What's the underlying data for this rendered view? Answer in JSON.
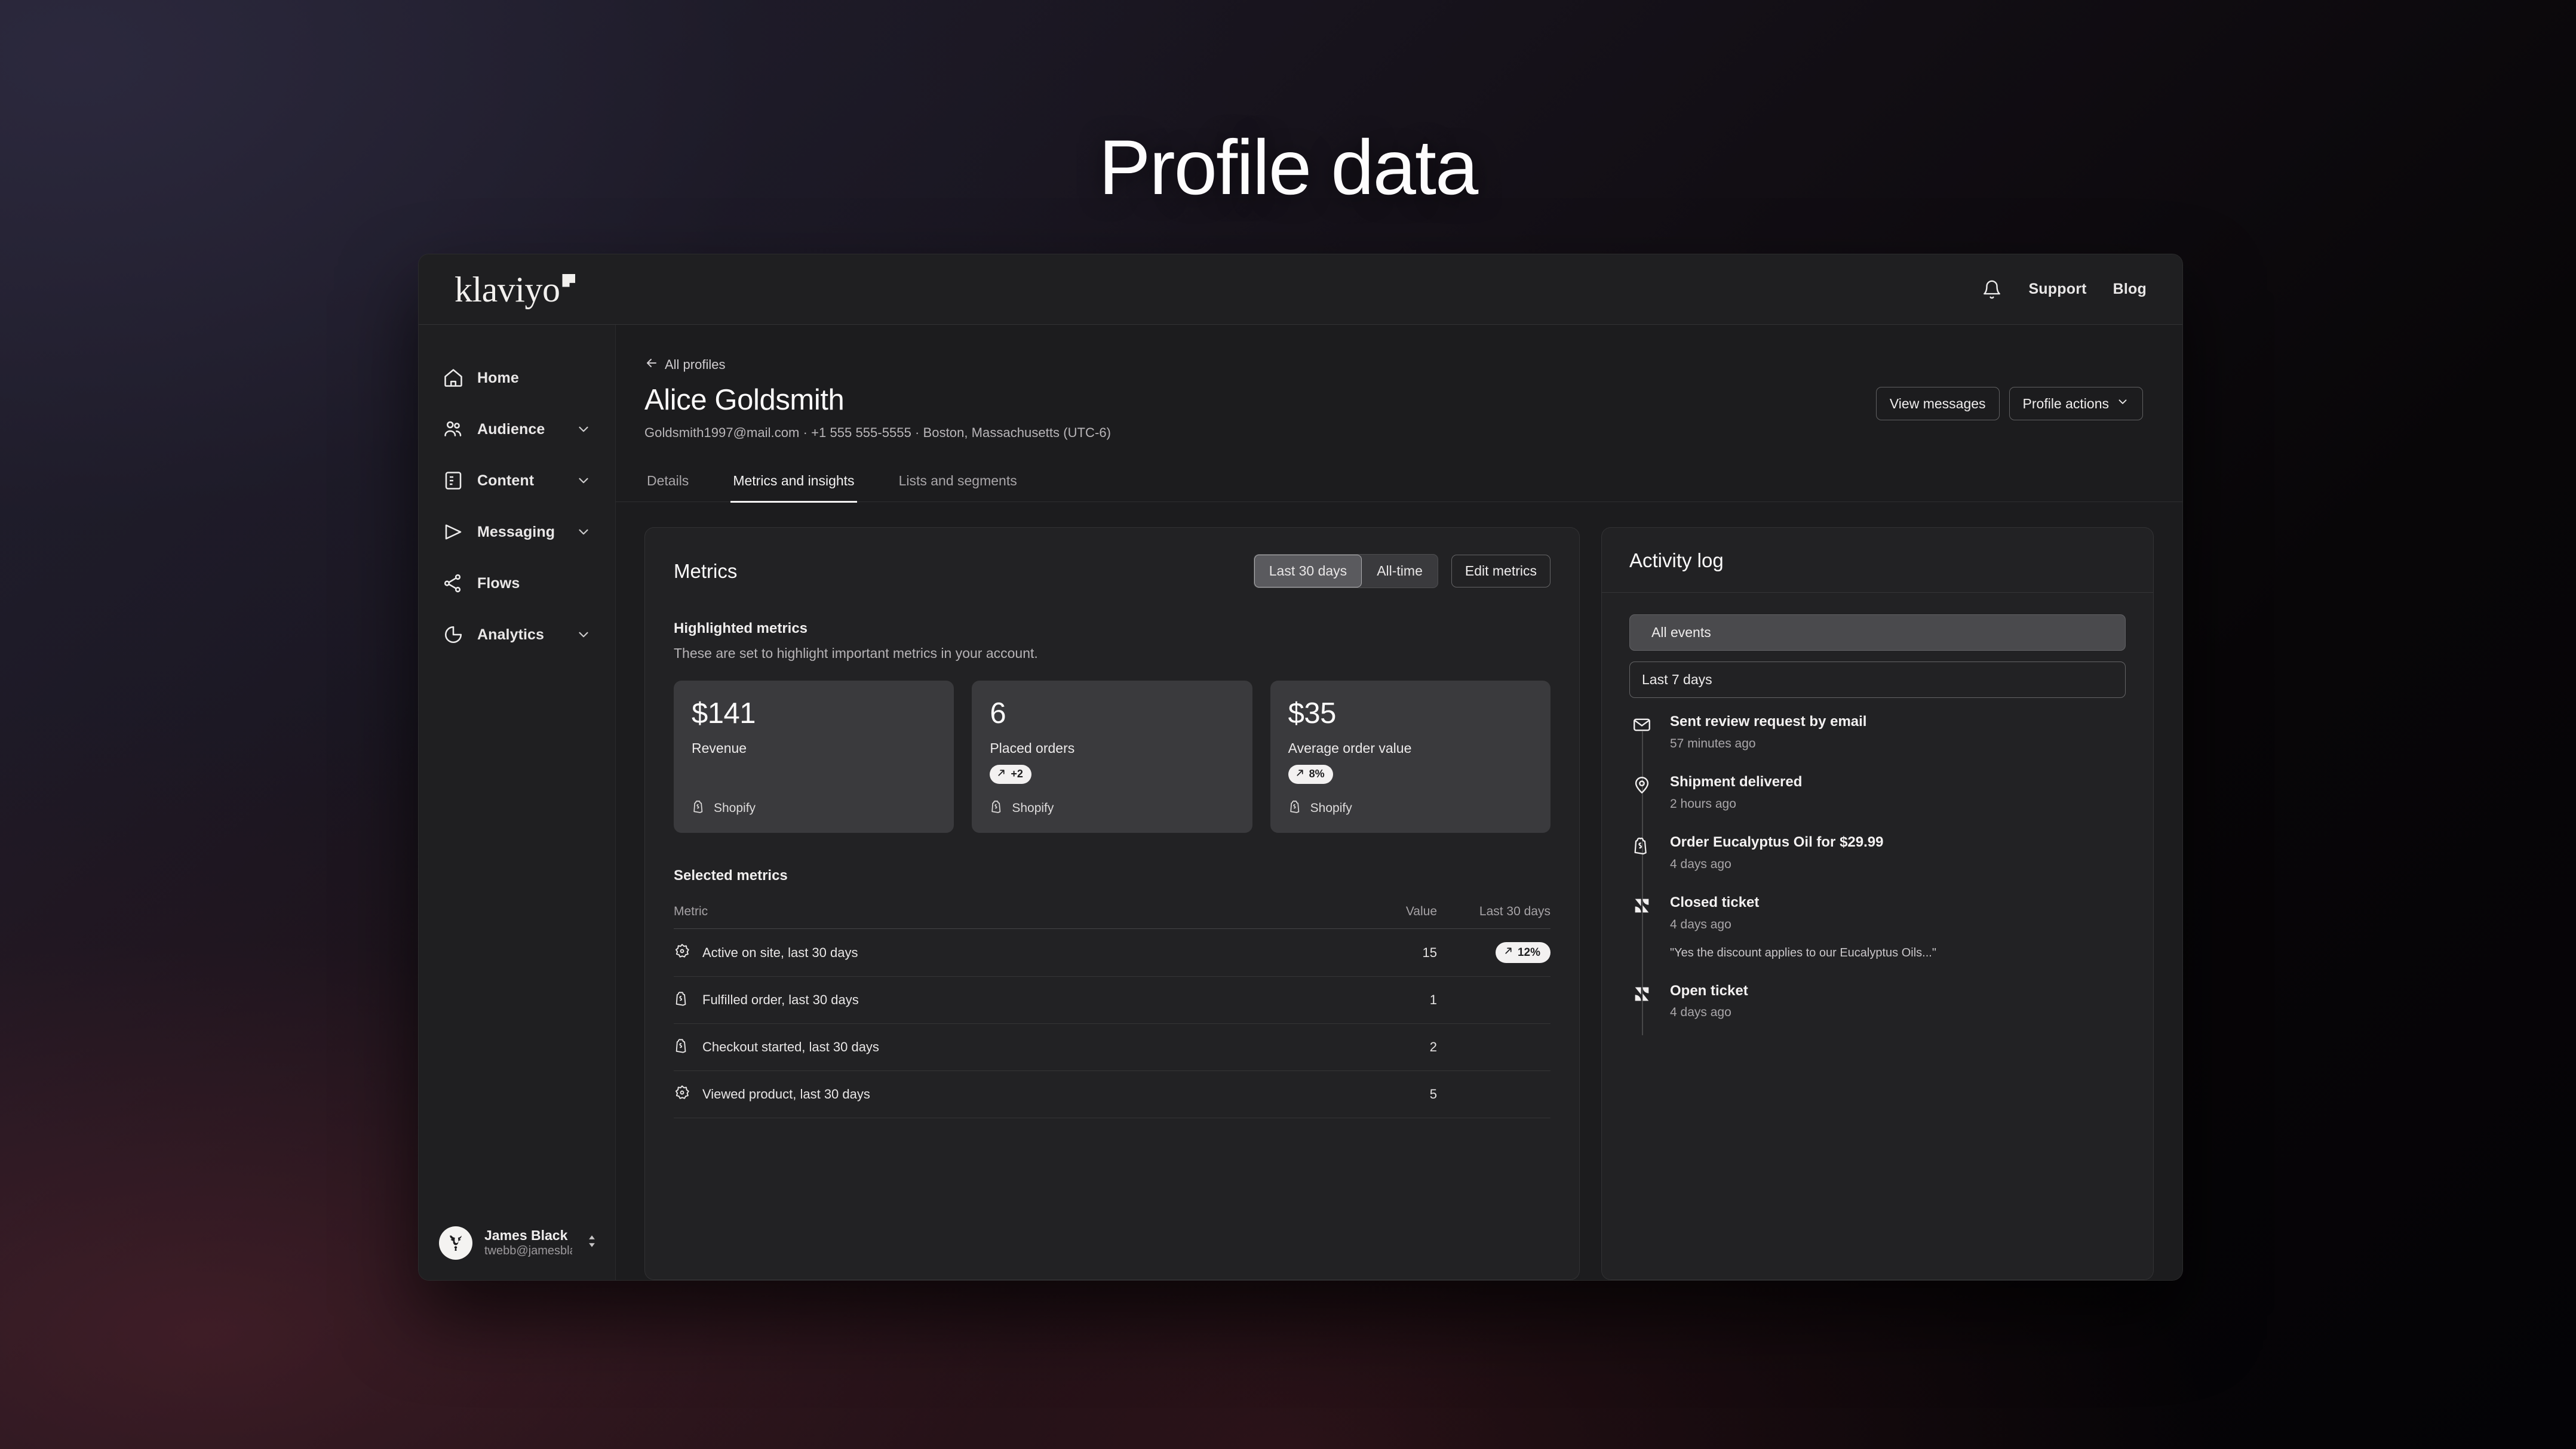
{
  "page": {
    "title": "Profile data"
  },
  "topbar": {
    "brand": "klaviyo",
    "bell_icon": "bell-icon",
    "links": [
      {
        "label": "Support"
      },
      {
        "label": "Blog"
      }
    ]
  },
  "sidebar": {
    "items": [
      {
        "label": "Home",
        "icon": "home-icon",
        "expandable": false
      },
      {
        "label": "Audience",
        "icon": "people-icon",
        "expandable": true
      },
      {
        "label": "Content",
        "icon": "document-icon",
        "expandable": true
      },
      {
        "label": "Messaging",
        "icon": "send-icon",
        "expandable": true
      },
      {
        "label": "Flows",
        "icon": "flows-icon",
        "expandable": false
      },
      {
        "label": "Analytics",
        "icon": "analytics-icon",
        "expandable": true
      }
    ],
    "user": {
      "name": "James Black",
      "email": "twebb@jamesbla...",
      "avatar_icon": "deer-head-avatar",
      "switcher_icon": "up-down-chevron-icon"
    }
  },
  "profile": {
    "back_link": "All profiles",
    "back_icon": "arrow-left-icon",
    "name": "Alice Goldsmith",
    "meta": "Goldsmith1997@mail.com  ·  +1 555 555-5555  ·  Boston, Massachusetts (UTC-6)",
    "actions": [
      {
        "label": "View messages",
        "icon": null
      },
      {
        "label": "Profile actions",
        "icon": "chevron-down-icon"
      }
    ],
    "tabs": [
      {
        "label": "Details",
        "active": false
      },
      {
        "label": "Metrics and insights",
        "active": true
      },
      {
        "label": "Lists and segments",
        "active": false
      }
    ]
  },
  "metrics": {
    "title": "Metrics",
    "range_options": [
      {
        "label": "Last 30 days",
        "active": true
      },
      {
        "label": "All-time",
        "active": false
      }
    ],
    "edit_label": "Edit metrics",
    "highlighted_title": "Highlighted metrics",
    "highlighted_desc": "These are set to highlight important metrics in your account.",
    "cards": [
      {
        "value": "$141",
        "label": "Revenue",
        "badge": null,
        "source": "Shopify",
        "source_icon": "shopify-icon"
      },
      {
        "value": "6",
        "label": "Placed orders",
        "badge": "+2",
        "badge_icon": "trend-up-icon",
        "source": "Shopify",
        "source_icon": "shopify-icon"
      },
      {
        "value": "$35",
        "label": "Average order value",
        "badge": "8%",
        "badge_icon": "trend-up-icon",
        "source": "Shopify",
        "source_icon": "shopify-icon"
      }
    ],
    "selected_title": "Selected metrics",
    "table": {
      "columns": [
        "Metric",
        "Value",
        "Last 30 days"
      ],
      "rows": [
        {
          "metric": "Active on site, last 30 days",
          "icon": "klaviyo-flower-icon",
          "value": "15",
          "trend": "12%",
          "trend_icon": "trend-up-icon"
        },
        {
          "metric": "Fulfilled order, last 30 days",
          "icon": "shopify-icon",
          "value": "1",
          "trend": null
        },
        {
          "metric": "Checkout started, last 30 days",
          "icon": "shopify-icon",
          "value": "2",
          "trend": null
        },
        {
          "metric": "Viewed product, last 30 days",
          "icon": "klaviyo-flower-icon",
          "value": "5",
          "trend": null
        }
      ]
    }
  },
  "activity": {
    "title": "Activity log",
    "event_filter": {
      "label": "All events",
      "icon": "lightning-icon",
      "chevron": "chevron-down-icon"
    },
    "date_filter": {
      "label": "Last 7 days",
      "chevron": "chevron-down-icon"
    },
    "events": [
      {
        "title": "Sent review request by email",
        "time": "57 minutes ago",
        "icon": "email-icon",
        "quote": null
      },
      {
        "title": "Shipment delivered",
        "time": "2 hours ago",
        "icon": "shipment-icon",
        "quote": null
      },
      {
        "title": "Order Eucalyptus Oil for $29.99",
        "time": "4 days ago",
        "icon": "shopify-icon",
        "quote": null
      },
      {
        "title": "Closed ticket",
        "time": "4 days ago",
        "icon": "zendesk-icon",
        "quote": "\"Yes the discount applies to our Eucalyptus Oils...\""
      },
      {
        "title": "Open ticket",
        "time": "4 days ago",
        "icon": "zendesk-icon",
        "quote": null
      }
    ]
  },
  "colors": {
    "surface": "#1c1c1e",
    "panel": "#222224",
    "card": "#3a3a3d",
    "text_primary": "#fbfafa",
    "text_muted": "#a9a6a9",
    "badge_bg": "#f3f1f1"
  }
}
